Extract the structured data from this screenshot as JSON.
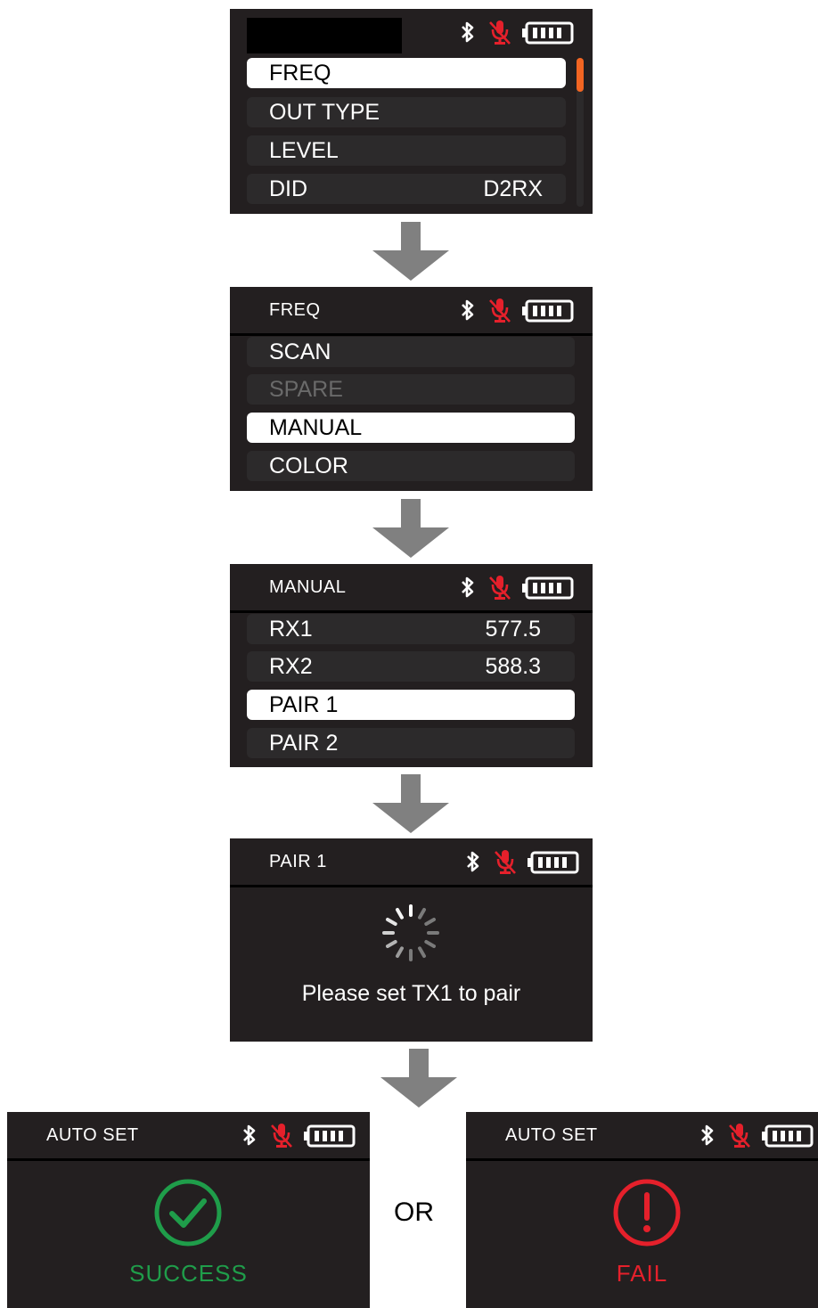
{
  "colors": {
    "screen_bg": "#231f20",
    "row_bg": "#2c2a2b",
    "selected_bg": "#ffffff",
    "mic_muted": "#e5202b",
    "success": "#1f9d4a",
    "fail": "#e5202b",
    "scrollbar_thumb": "#f26522",
    "arrow": "#808080"
  },
  "screen1": {
    "title": "",
    "items": [
      {
        "label": "FREQ",
        "value": ""
      },
      {
        "label": "OUT TYPE",
        "value": ""
      },
      {
        "label": "LEVEL",
        "value": ""
      },
      {
        "label": "DID",
        "value": "D2RX"
      }
    ]
  },
  "screen2": {
    "title": "FREQ",
    "items": [
      {
        "label": "SCAN"
      },
      {
        "label": "SPARE"
      },
      {
        "label": "MANUAL"
      },
      {
        "label": "COLOR"
      }
    ]
  },
  "screen3": {
    "title": "MANUAL",
    "items": [
      {
        "label": "RX1",
        "value": "577.5"
      },
      {
        "label": "RX2",
        "value": "588.3"
      },
      {
        "label": "PAIR 1",
        "value": ""
      },
      {
        "label": "PAIR 2",
        "value": ""
      }
    ]
  },
  "screen4": {
    "title": "PAIR 1",
    "message": "Please set TX1 to pair"
  },
  "screen5": {
    "title": "AUTO SET",
    "result": "SUCCESS",
    "icon": "check-circle-icon"
  },
  "screen6": {
    "title": "AUTO SET",
    "result": "FAIL",
    "icon": "exclamation-circle-icon"
  },
  "or_label": "OR",
  "status_icons": [
    "bluetooth-icon",
    "mic-muted-icon",
    "battery-icon"
  ]
}
